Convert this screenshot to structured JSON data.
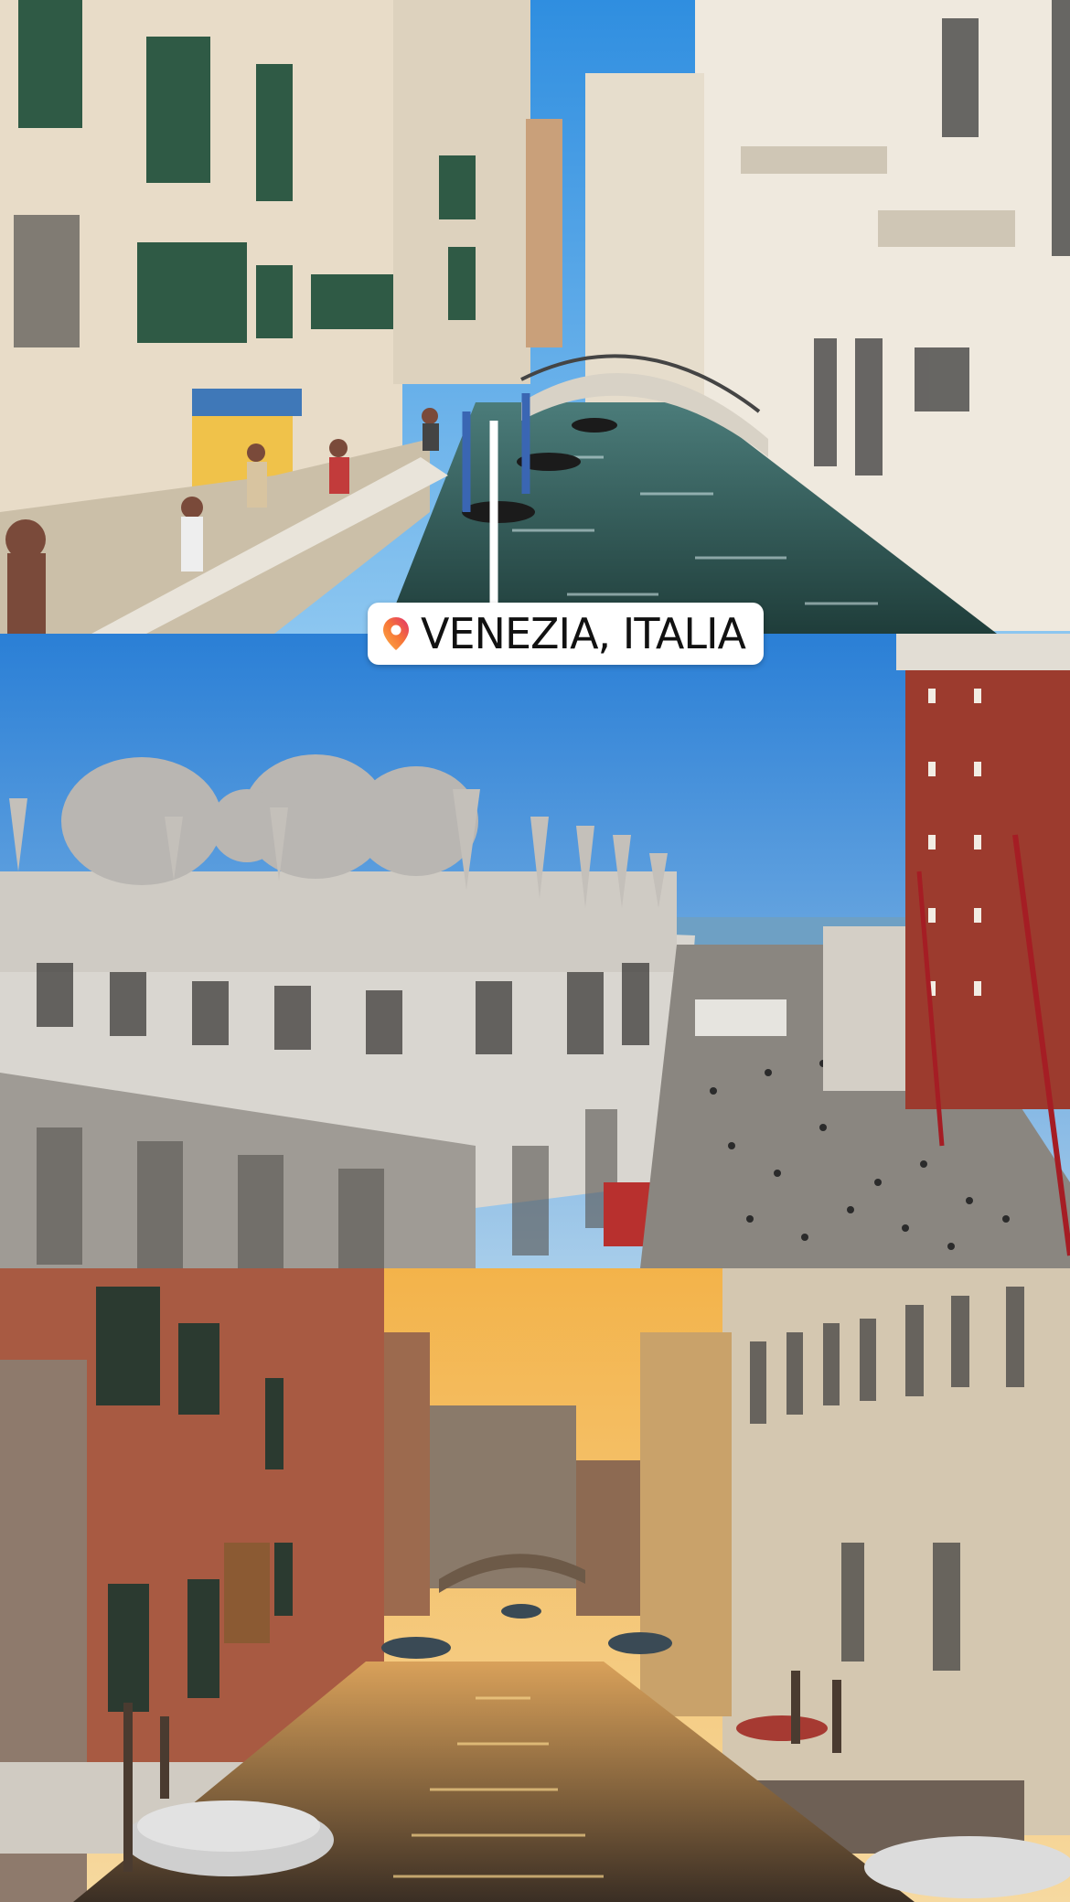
{
  "collage": {
    "panels": [
      {
        "scene": "canal-bridge-daytime"
      },
      {
        "scene": "piazza-san-marco-aerial"
      },
      {
        "scene": "canal-at-sunset"
      }
    ]
  },
  "location_sticker": {
    "label": "VENEZIA, ITALIA",
    "icon": "location-pin-icon",
    "pin_gradient": [
      "#e1306c",
      "#f77737",
      "#fcaf45"
    ]
  }
}
